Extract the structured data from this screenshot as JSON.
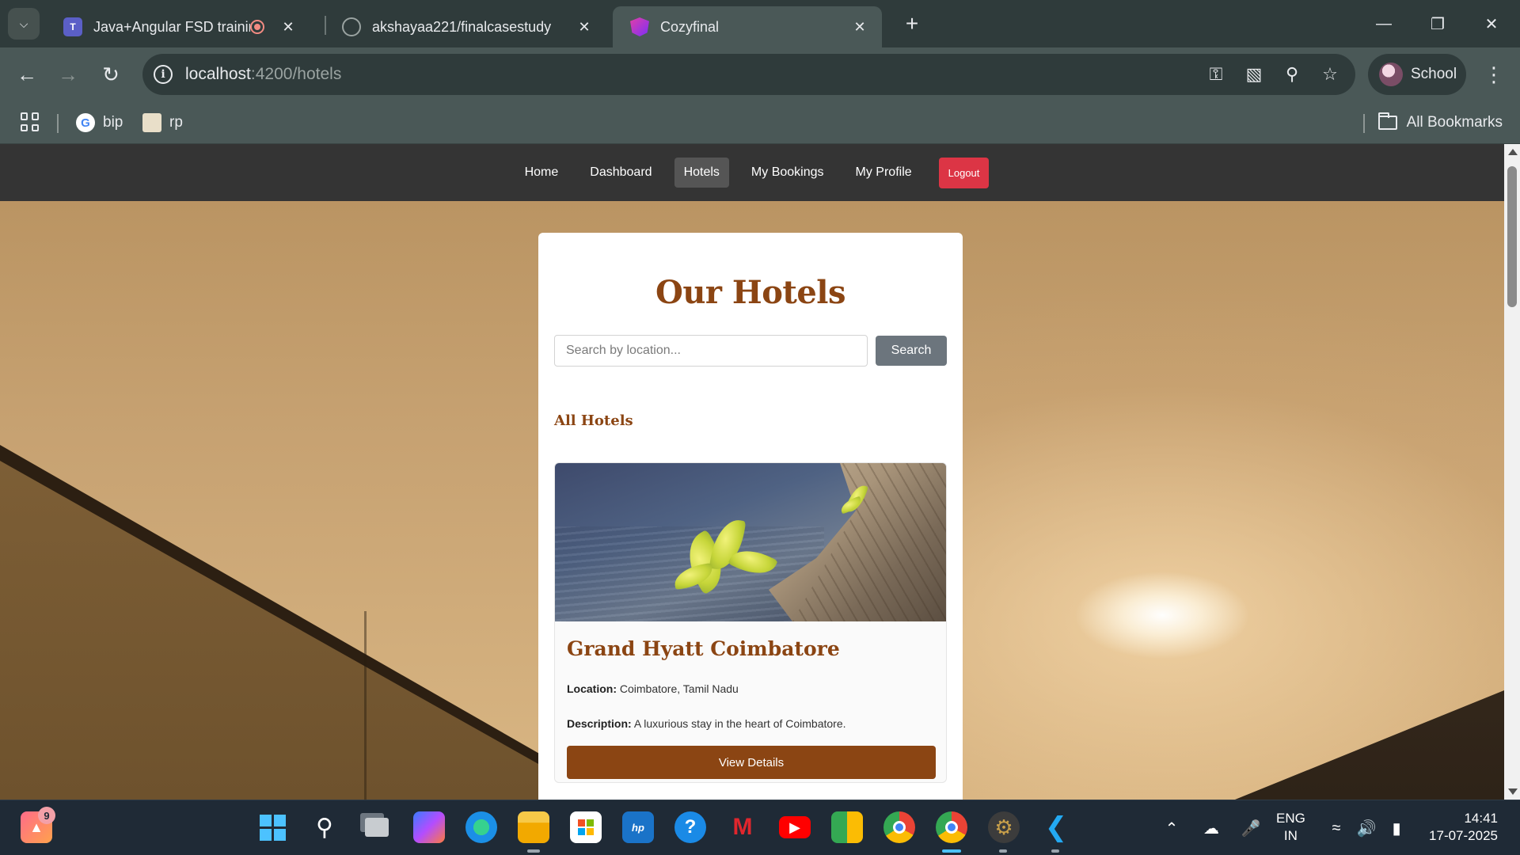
{
  "browser": {
    "tabs": [
      {
        "title": "Java+Angular FSD training",
        "favicon": "teams-icon",
        "recording": true
      },
      {
        "title": "akshayaa221/finalcasestudy",
        "favicon": "github-icon",
        "recording": false
      },
      {
        "title": "Cozyfinal",
        "favicon": "angular-icon",
        "recording": false,
        "active": true
      }
    ],
    "url_host": "localhost",
    "url_path": ":4200/hotels",
    "profile_label": "School",
    "bookmarks": [
      {
        "label": "bip",
        "icon": "google-icon"
      },
      {
        "label": "rp",
        "icon": "image-icon"
      }
    ],
    "all_bookmarks_label": "All Bookmarks"
  },
  "app": {
    "nav": {
      "home": "Home",
      "dashboard": "Dashboard",
      "hotels": "Hotels",
      "bookings": "My Bookings",
      "profile": "My Profile",
      "logout": "Logout",
      "active": "Hotels"
    },
    "page_title": "Our Hotels",
    "search": {
      "placeholder": "Search by location...",
      "value": "",
      "button_label": "Search"
    },
    "section_title": "All Hotels",
    "hotels": [
      {
        "name": "Grand Hyatt Coimbatore",
        "location_label": "Location:",
        "location": "Coimbatore, Tamil Nadu",
        "description_label": "Description:",
        "description": "A luxurious stay in the heart of Coimbatore.",
        "button_label": "View Details"
      }
    ],
    "colors": {
      "brand": "#8b4513",
      "nav_bg": "#343434",
      "logout": "#dc3545",
      "search_button": "#6c757d"
    }
  },
  "taskbar": {
    "notification_count": "9",
    "language_top": "ENG",
    "language_bottom": "IN",
    "time": "14:41",
    "date": "17-07-2025",
    "apps": [
      "widgets-icon",
      "start-icon",
      "search-icon",
      "task-view-icon",
      "copilot-icon",
      "edge-icon",
      "file-explorer-icon",
      "store-icon",
      "myhp-icon",
      "help-icon",
      "mcafee-icon",
      "youtube-icon",
      "meet-icon",
      "chrome-icon",
      "chrome-profile-icon",
      "settings-icon",
      "vscode-icon"
    ]
  }
}
